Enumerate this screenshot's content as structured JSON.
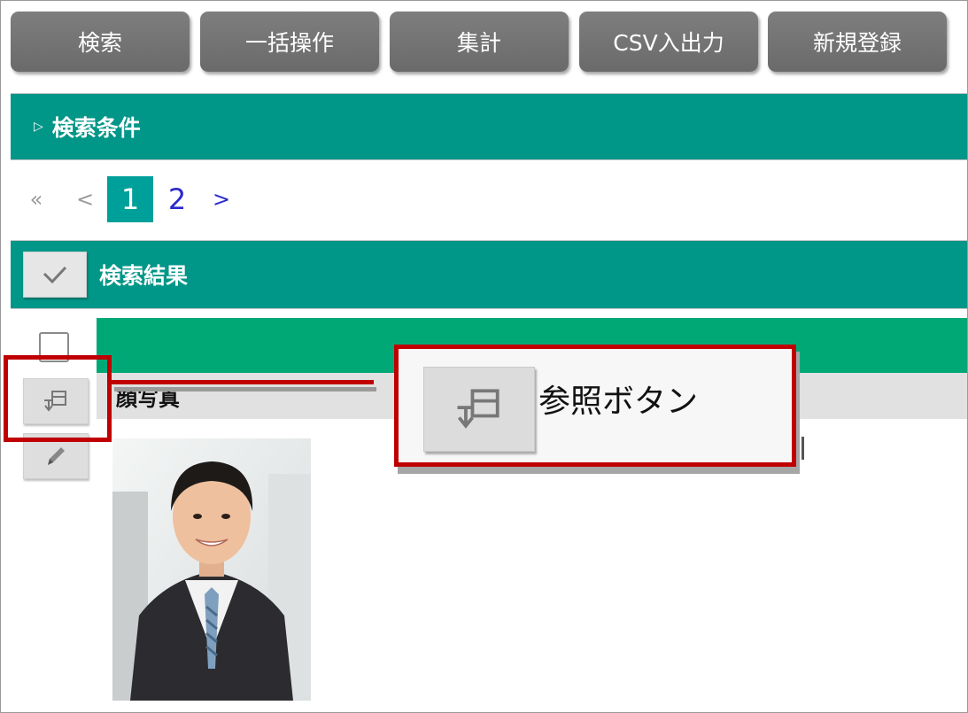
{
  "toolbar": {
    "search_label": "検索",
    "bulk_label": "一括操作",
    "aggregate_label": "集計",
    "csv_label": "CSV入出力",
    "new_label": "新規登録"
  },
  "search_conditions": {
    "toggle_icon": "triangle-right-icon",
    "label": "検索条件"
  },
  "pagination": {
    "first": "«",
    "prev": "<",
    "current": "1",
    "page2": "2",
    "next": ">"
  },
  "results": {
    "label": "検索結果",
    "check_all_icon": "checkmark-icon",
    "photo_column_label": "顔写真",
    "view_button_icon": "view-detail-icon",
    "edit_button_icon": "pencil-icon",
    "photo_icon": "person-photo"
  },
  "annotation": {
    "label": "参照ボタン",
    "icon": "view-detail-icon"
  },
  "colors": {
    "toolbar_button": "#6f6f6f",
    "teal_bar": "#009688",
    "green_header": "#00a876",
    "current_page": "#00a09a",
    "link_blue": "#2a2acd",
    "highlight_red": "#c00000"
  }
}
